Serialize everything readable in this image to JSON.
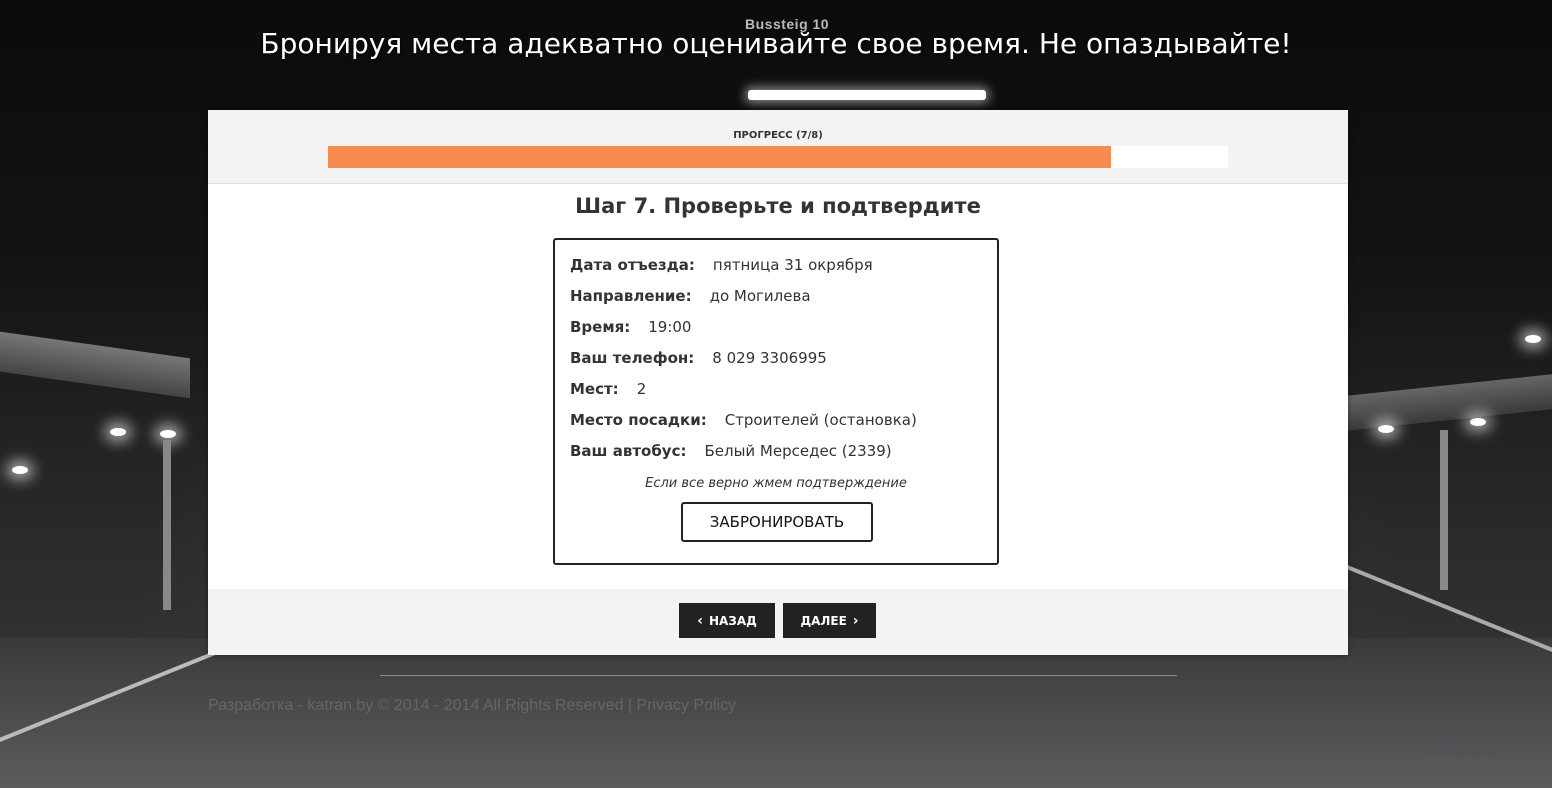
{
  "background": {
    "sign_text": "Bussteig 10"
  },
  "headline": "Бронируя места адекватно оценивайте свое время. Не опаздывайте!",
  "progress": {
    "label": "ПРОГРЕСС (7/8)",
    "current": 7,
    "total": 8,
    "fraction": 0.87,
    "fill_color": "#f68c52"
  },
  "step": {
    "title": "Шаг 7. Проверьте и подтвердите"
  },
  "summary": {
    "rows": [
      {
        "label": "Дата отъезда:",
        "value": "пятница 31 окрября"
      },
      {
        "label": "Направление:",
        "value": "до Могилева"
      },
      {
        "label": "Время:",
        "value": "19:00"
      },
      {
        "label": "Ваш телефон:",
        "value": "8 029 3306995"
      },
      {
        "label": "Мест:",
        "value": "2"
      },
      {
        "label": "Место посадки:",
        "value": "Строителей (остановка)"
      },
      {
        "label": "Ваш автобус:",
        "value": "Белый Мерседес (2339)"
      }
    ],
    "note": "Если все верно жмем подтверждение",
    "book_label": "ЗАБРОНИРОВАТЬ"
  },
  "nav": {
    "back_label": "НАЗАД",
    "next_label": "ДАЛЕЕ",
    "back_icon": "chevron-left-icon",
    "next_icon": "chevron-right-icon"
  },
  "footer": {
    "copyright_prefix": "Разработка - katran.by © 2014 - 2014 All Rights Reserved",
    "separator": "|",
    "privacy_label": "Privacy Policy",
    "watermark": "katran.by"
  }
}
